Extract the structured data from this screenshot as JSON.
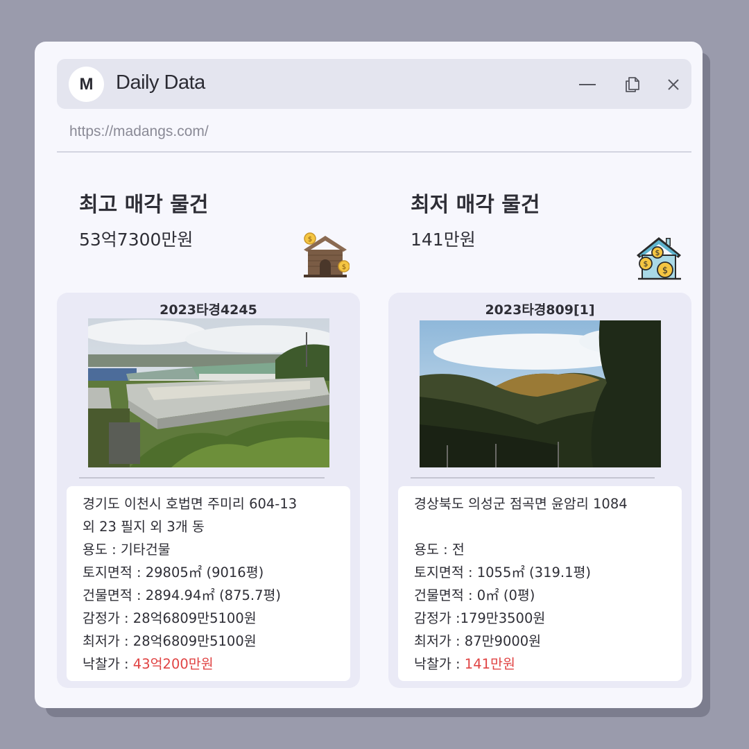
{
  "window": {
    "logo_letter": "M",
    "title": "Daily Data",
    "url": "https://madangs.com/",
    "controls": [
      "minimize-icon",
      "restore-icon",
      "close-icon"
    ]
  },
  "highest": {
    "heading": "최고 매각 물건",
    "price": "53억7300만원",
    "icon": "house-money-icon",
    "case_id": "2023타경4245",
    "address1": "경기도 이천시 호법면 주미리 604-13",
    "address2": "외 23 필지 외 3개 동",
    "usage": "용도 : 기타건물",
    "land_area": "토지면적 : 29805㎡ (9016평)",
    "building_area": "건물면적 : 2894.94㎡ (875.7평)",
    "appraisal": "감정가 : 28억6809만5100원",
    "minimum": "최저가 : 28억6809만5100원",
    "winning_label": "낙찰가 : ",
    "winning_value": "43억200만원"
  },
  "lowest": {
    "heading": "최저 매각 물건",
    "price": "141만원",
    "icon": "house-coins-icon",
    "case_id": "2023타경809[1]",
    "address1": "경상북도 의성군 점곡면 윤암리 1084",
    "address2": "",
    "usage": "용도 : 전",
    "land_area": "토지면적 : 1055㎡ (319.1평)",
    "building_area": "건물면적 : 0㎡ (0평)",
    "appraisal": "감정가 :179만3500원",
    "minimum": "최저가 : 87만9000원",
    "winning_label": "낙찰가 : ",
    "winning_value": "141만원"
  },
  "colors": {
    "background": "#9a9bac",
    "window": "#f7f7fd",
    "titlebar": "#e4e5ef",
    "card": "#eaeaf6",
    "accent_red": "#e04444"
  }
}
